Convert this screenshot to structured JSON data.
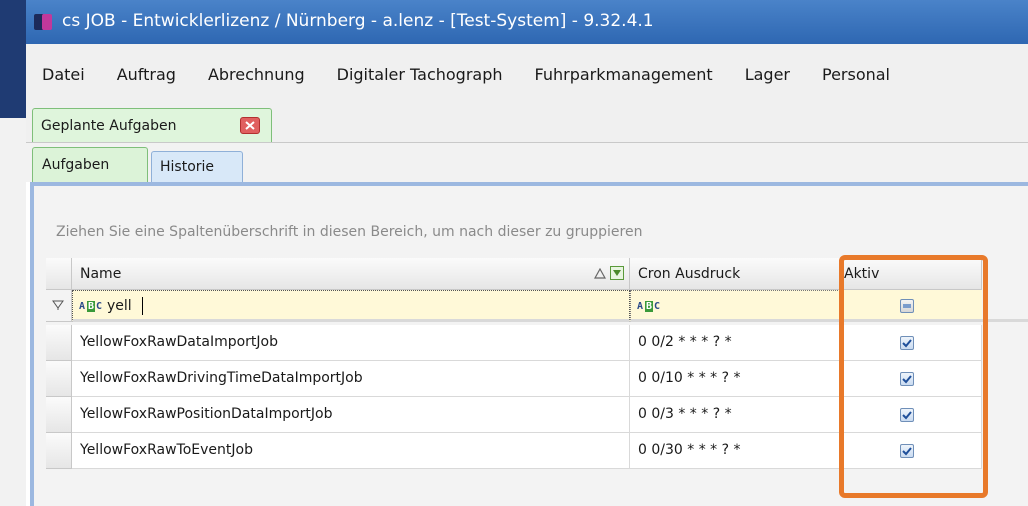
{
  "window": {
    "title": "cs JOB - Entwicklerlizenz / Nürnberg - a.lenz - [Test-System] - 9.32.4.1"
  },
  "menu": {
    "items": [
      "Datei",
      "Auftrag",
      "Abrechnung",
      "Digitaler Tachograph",
      "Fuhrparkmanagement",
      "Lager",
      "Personal"
    ]
  },
  "doc_tab": {
    "label": "Geplante Aufgaben"
  },
  "tabs": {
    "aufgaben": "Aufgaben",
    "historie": "Historie"
  },
  "grid": {
    "group_hint": "Ziehen Sie eine Spaltenüberschrift in diesen Bereich, um nach dieser zu gruppieren",
    "columns": {
      "name": "Name",
      "cron": "Cron Ausdruck",
      "aktiv": "Aktiv"
    },
    "filter": {
      "name_value": "yell",
      "abc_label": "ABC"
    },
    "rows": [
      {
        "name": "YellowFoxRawDataImportJob",
        "cron": "0 0/2 * * * ? *",
        "aktiv": true
      },
      {
        "name": "YellowFoxRawDrivingTimeDataImportJob",
        "cron": "0 0/10 * * * ? *",
        "aktiv": true
      },
      {
        "name": "YellowFoxRawPositionDataImportJob",
        "cron": "0 0/3 * * * ? *",
        "aktiv": true
      },
      {
        "name": "YellowFoxRawToEventJob",
        "cron": "0 0/30 * * * ? *",
        "aktiv": true
      }
    ]
  },
  "colors": {
    "highlight": "#e8792a",
    "titlebar": "#3a74bf",
    "filter_bg": "#fff9d8"
  }
}
